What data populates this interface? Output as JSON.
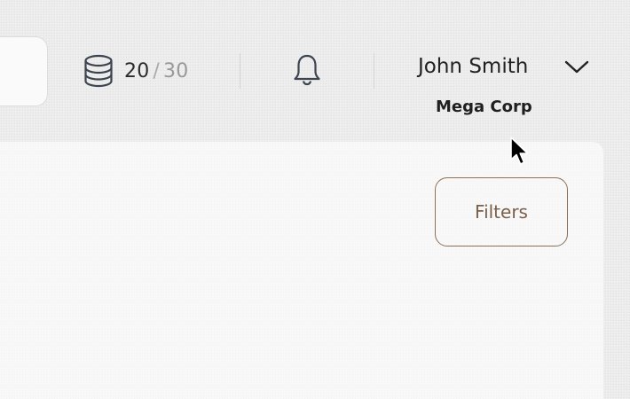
{
  "header": {
    "credits": {
      "icon": "database-icon",
      "used": "20",
      "separator": "/",
      "total": "30"
    },
    "notifications": {
      "icon": "bell-icon"
    },
    "user": {
      "name": "John Smith",
      "organization": "Mega Corp",
      "icon": "chevron-down-icon"
    }
  },
  "main": {
    "filters_label": "Filters"
  },
  "colors": {
    "accent_border": "#8b6f57",
    "accent_text": "#7a5f49",
    "muted_text": "#999999"
  }
}
